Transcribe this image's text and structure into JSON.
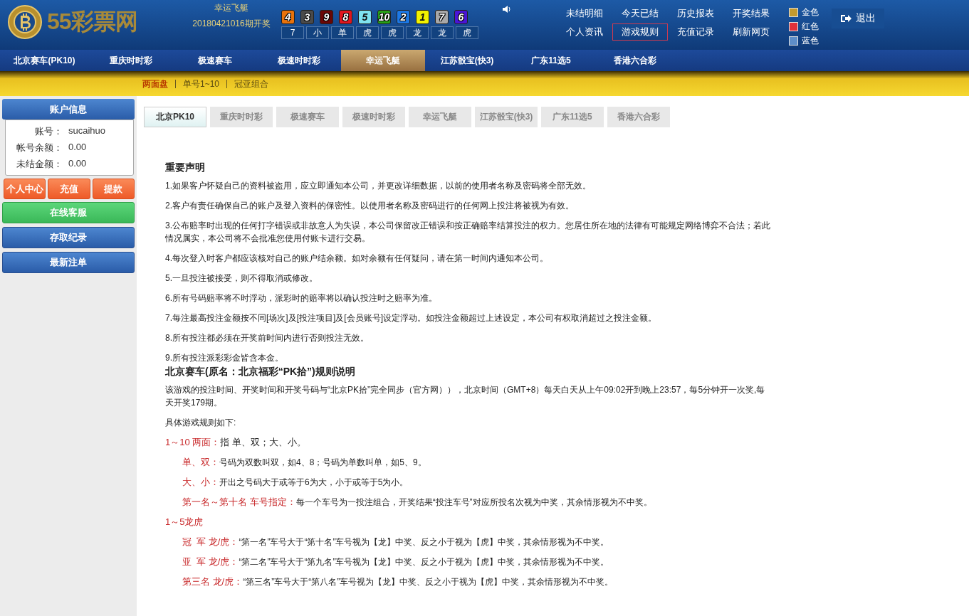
{
  "header": {
    "logo": "55彩票网",
    "game": "幸运飞艇",
    "period": "20180421016期开奖",
    "balls": [
      {
        "number": "4",
        "color": "#e8720c"
      },
      {
        "number": "3",
        "color": "#4a4a4a"
      },
      {
        "number": "9",
        "color": "#6a0606"
      },
      {
        "number": "8",
        "color": "#e0161e"
      },
      {
        "number": "5",
        "color": "#7fe3f0"
      },
      {
        "number": "10",
        "color": "#27a018"
      },
      {
        "number": "2",
        "color": "#1c78e6"
      },
      {
        "number": "1",
        "color": "#f2f200"
      },
      {
        "number": "7",
        "color": "#a8a8a8"
      },
      {
        "number": "6",
        "color": "#4a14d6"
      }
    ],
    "results": [
      "7",
      "小",
      "单",
      "虎",
      "虎",
      "龙",
      "龙",
      "虎"
    ],
    "links": [
      {
        "label": "未结明细",
        "selected": false
      },
      {
        "label": "今天已结",
        "selected": false
      },
      {
        "label": "历史报表",
        "selected": false
      },
      {
        "label": "开奖结果",
        "selected": false
      },
      {
        "label": "个人资讯",
        "selected": false
      },
      {
        "label": "游戏规则",
        "selected": true
      },
      {
        "label": "充值记录",
        "selected": false
      },
      {
        "label": "刷新网页",
        "selected": false
      }
    ],
    "themes": [
      {
        "label": "金色",
        "color": "#c49a2c"
      },
      {
        "label": "红色",
        "color": "#e0303a"
      },
      {
        "label": "蓝色",
        "color": "#5e8ec8"
      }
    ],
    "logout": "退出"
  },
  "nav": [
    {
      "label": "北京赛车(PK10)",
      "selected": false
    },
    {
      "label": "重庆时时彩",
      "selected": false
    },
    {
      "label": "极速赛车",
      "selected": false
    },
    {
      "label": "极速时时彩",
      "selected": false
    },
    {
      "label": "幸运飞艇",
      "selected": true
    },
    {
      "label": "江苏骰宝(快3)",
      "selected": false
    },
    {
      "label": "广东11选5",
      "selected": false
    },
    {
      "label": "香港六合彩",
      "selected": false
    }
  ],
  "subnav": [
    {
      "label": "两面盘",
      "selected": true
    },
    {
      "label": "单号1~10",
      "selected": false
    },
    {
      "label": "冠亚组合",
      "selected": false
    }
  ],
  "sidebar": {
    "title": "账户信息",
    "fields": [
      {
        "label": "账号：",
        "value": "sucaihuo"
      },
      {
        "label": "帐号余额：",
        "value": "0.00"
      },
      {
        "label": "未结金额：",
        "value": "0.00"
      }
    ],
    "actions": [
      "个人中心",
      "充值",
      "提款"
    ],
    "menu": [
      {
        "label": "在线客服",
        "kind": "green"
      },
      {
        "label": "存取纪录",
        "kind": "blue"
      },
      {
        "label": "最新注单",
        "kind": "blue"
      }
    ]
  },
  "tabs": [
    {
      "label": "北京PK10",
      "selected": true
    },
    {
      "label": "重庆时时彩",
      "selected": false
    },
    {
      "label": "极速赛车",
      "selected": false
    },
    {
      "label": "极速时时彩",
      "selected": false
    },
    {
      "label": "幸运飞艇",
      "selected": false
    },
    {
      "label": "江苏骰宝(快3)",
      "selected": false
    },
    {
      "label": "广东11选5",
      "selected": false
    },
    {
      "label": "香港六合彩",
      "selected": false
    }
  ],
  "rules": [
    {
      "kind": "heading",
      "text": "重要声明"
    },
    {
      "kind": "para",
      "text": "1.如果客户怀疑自己的资料被盗用，应立即通知本公司，并更改详细数据，以前的使用者名称及密码将全部无效。"
    },
    {
      "kind": "para",
      "text": "2.客户有责任确保自己的账户及登入资料的保密性。以使用者名称及密码进行的任何网上投注将被视为有效。"
    },
    {
      "kind": "para",
      "text": "3.公布赔率时出现的任何打字错误或非故意人为失误，本公司保留改正错误和按正确赔率结算投注的权力。您居住所在地的法律有可能规定网络博弈不合法；若此情况属实，本公司将不会批准您使用付账卡进行交易。"
    },
    {
      "kind": "para",
      "text": "4.每次登入时客户都应该核对自己的账户结余额。如对余额有任何疑问，请在第一时间内通知本公司。"
    },
    {
      "kind": "para",
      "text": "5.一旦投注被接受，则不得取消或修改。"
    },
    {
      "kind": "para",
      "text": "6.所有号码赔率将不时浮动，派彩时的赔率将以确认投注时之赔率为准。"
    },
    {
      "kind": "para",
      "text": "7.每注最高投注金额按不同[场次]及[投注项目]及[会员账号]设定浮动。如投注金额超过上述设定，本公司有权取消超过之投注金额。"
    },
    {
      "kind": "para",
      "text": "8.所有投注都必须在开奖前时间内进行否则投注无效。"
    },
    {
      "kind": "tight",
      "text": "9.所有投注派彩彩金皆含本金。"
    },
    {
      "kind": "heading",
      "text": "北京赛车(原名：北京福彩“PK拾”)规则说明"
    },
    {
      "kind": "para",
      "text": "该游戏的投注时间、开奖时间和开奖号码与“北京PK拾”完全同步（官方网）），北京时间（GMT+8）每天白天从上午09:02开到晚上23:57，每5分钟开一次奖,每天开奖179期。"
    },
    {
      "kind": "para",
      "text": "具体游戏规则如下:"
    },
    {
      "kind": "section",
      "label": "1～10 两面：",
      "text": "指 单、双；大、小。"
    },
    {
      "kind": "item",
      "label": "单、双：",
      "text": "号码为双数叫双，如4、8；号码为单数叫单，如5、9。"
    },
    {
      "kind": "item",
      "label": "大、小：",
      "text": "开出之号码大于或等于6为大，小于或等于5为小。"
    },
    {
      "kind": "item",
      "label": "第一名～第十名 车号指定：",
      "text": "每一个车号为一投注组合，开奖结果“投注车号”对应所投名次视为中奖，其余情形视为不中奖。"
    },
    {
      "kind": "section",
      "label": "1～5龙虎"
    },
    {
      "kind": "item",
      "label": "冠  军 龙/虎：",
      "text": "“第一名”车号大于“第十名”车号视为【龙】中奖、反之小于视为【虎】中奖，其余情形视为不中奖。"
    },
    {
      "kind": "item",
      "label": "亚  军 龙/虎：",
      "text": "“第二名”车号大于“第九名”车号视为【龙】中奖、反之小于视为【虎】中奖，其余情形视为不中奖。"
    },
    {
      "kind": "item",
      "label": "第三名 龙/虎：",
      "text": "“第三名”车号大于“第八名”车号视为【龙】中奖、反之小于视为【虎】中奖，其余情形视为不中奖。"
    }
  ]
}
